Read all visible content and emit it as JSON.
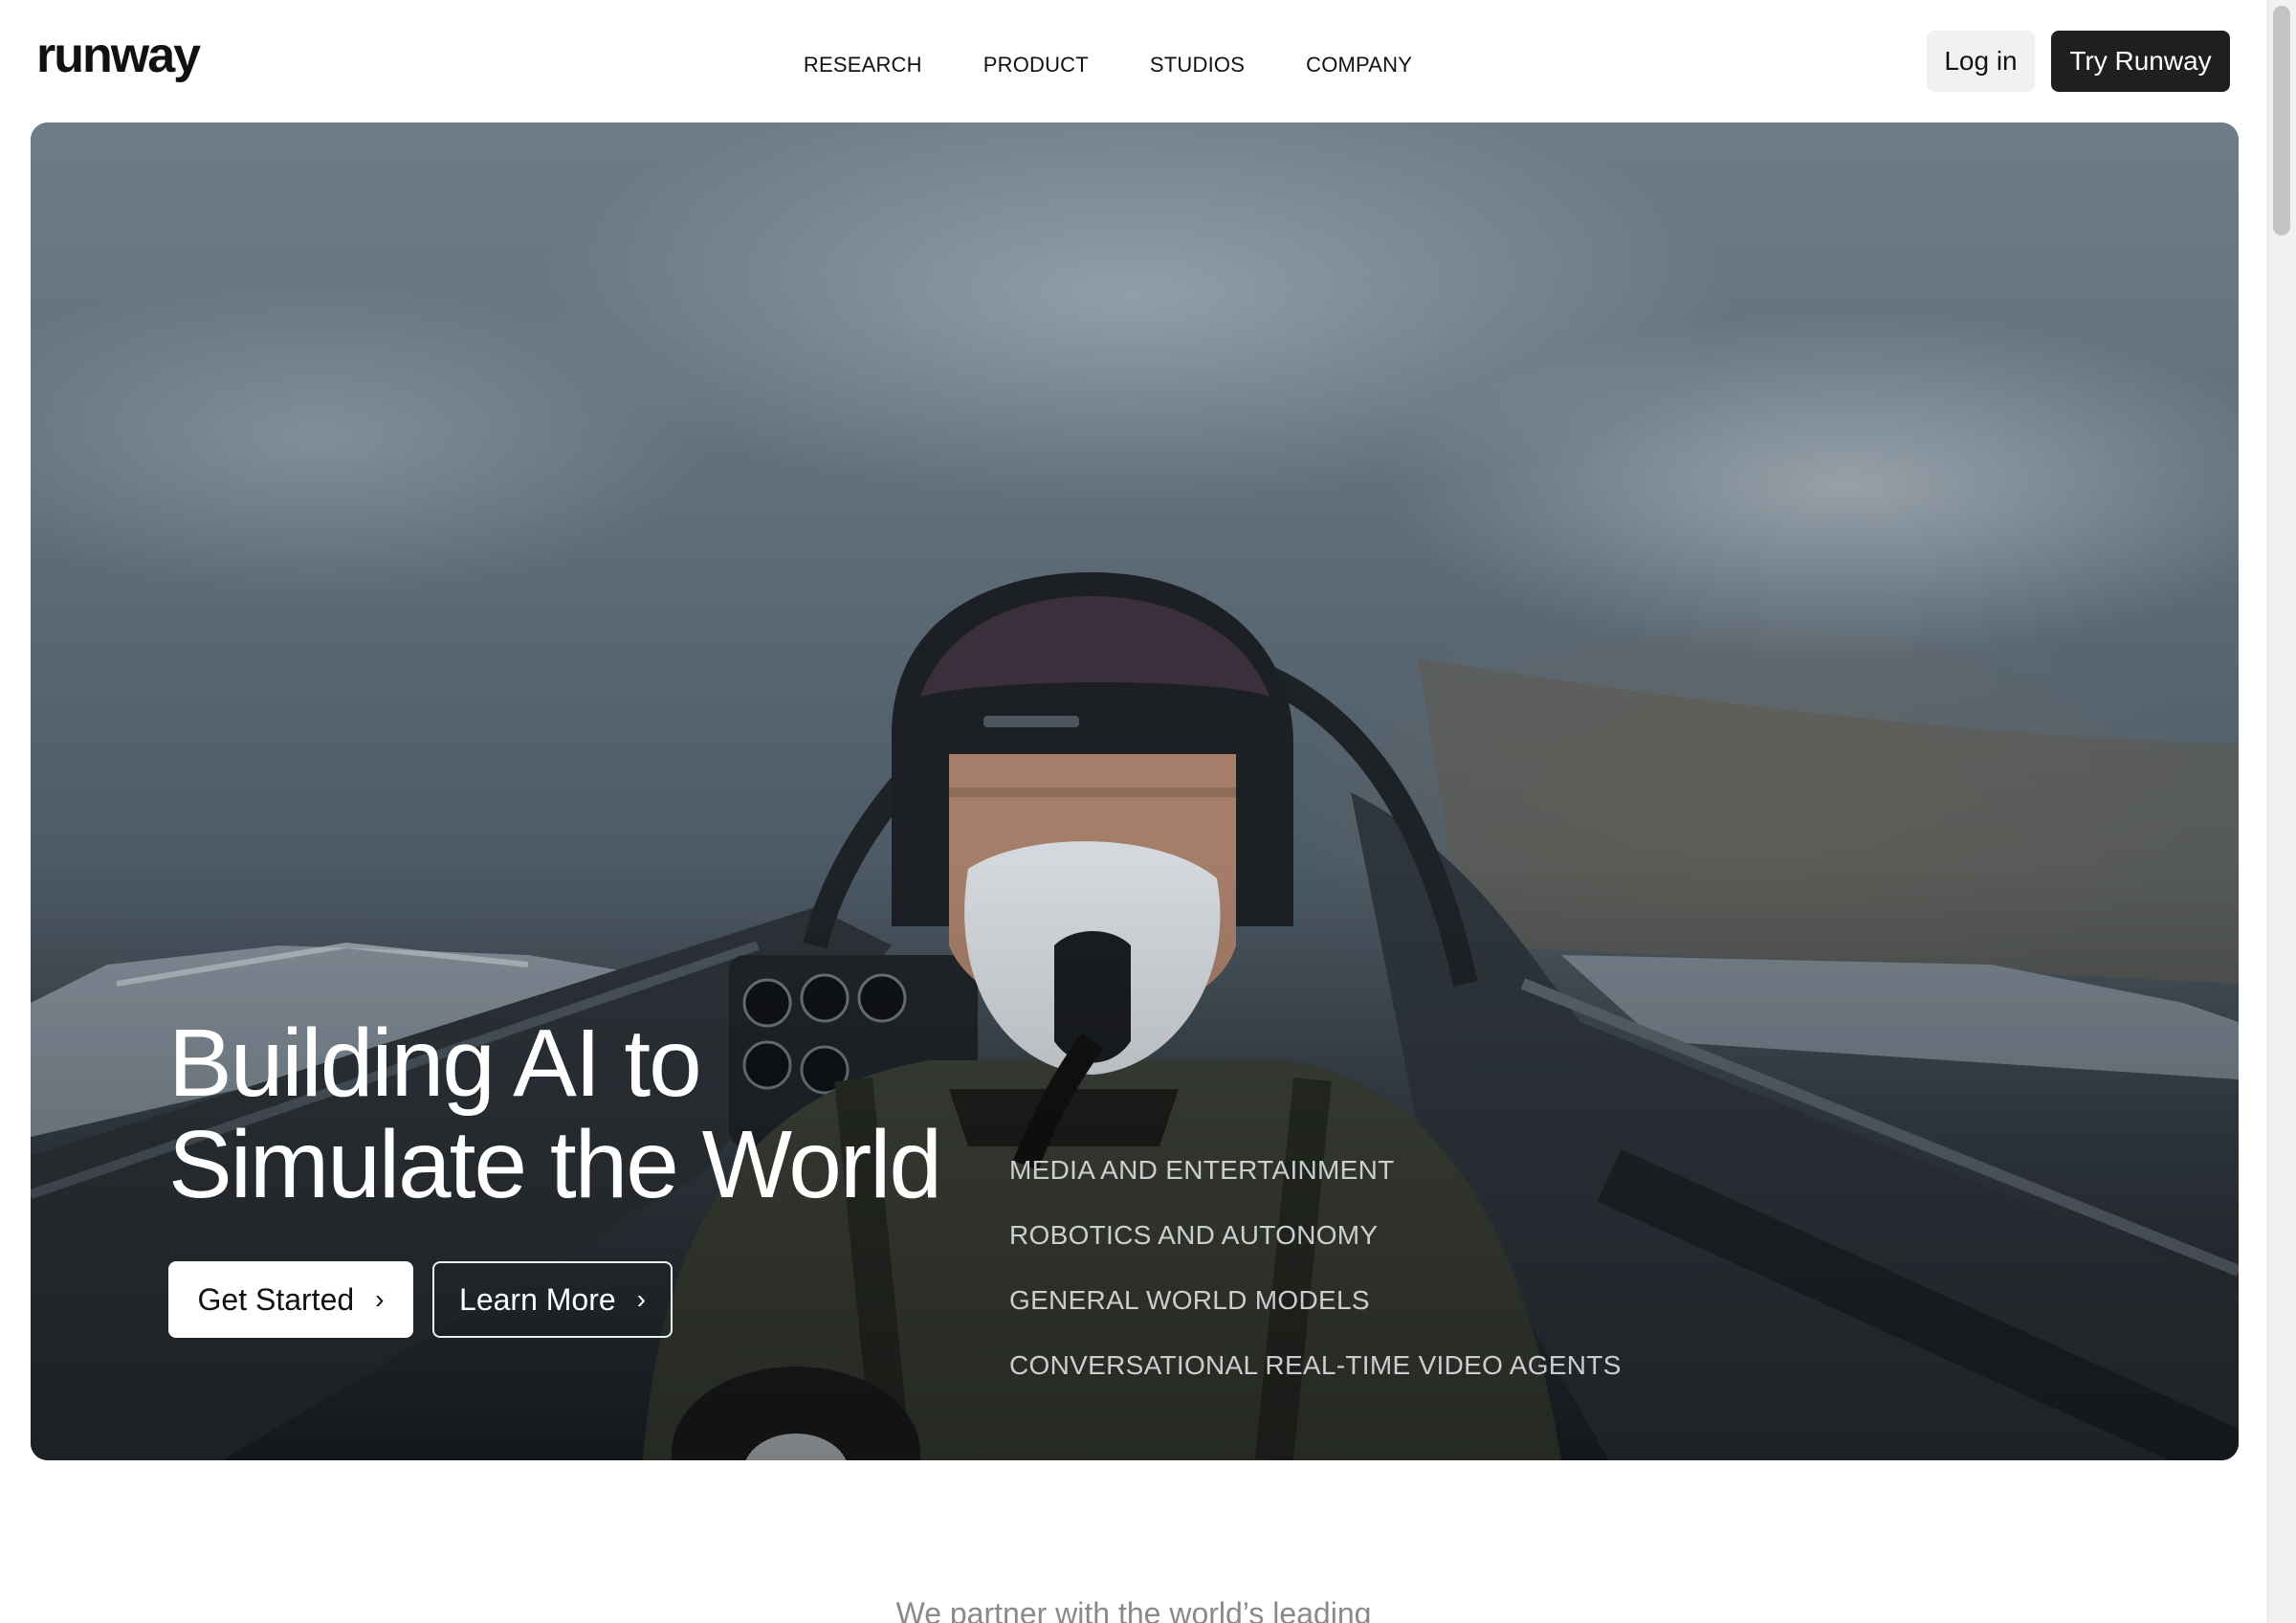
{
  "header": {
    "logo": "runway",
    "nav": [
      "RESEARCH",
      "PRODUCT",
      "STUDIOS",
      "COMPANY"
    ],
    "login_label": "Log in",
    "try_label": "Try Runway"
  },
  "hero": {
    "title_line1": "Building AI to",
    "title_line2": "Simulate the World",
    "get_started_label": "Get Started",
    "learn_more_label": "Learn More",
    "sectors": [
      "MEDIA AND ENTERTAINMENT",
      "ROBOTICS AND AUTONOMY",
      "GENERAL WORLD MODELS",
      "CONVERSATIONAL REAL-TIME VIDEO AGENTS"
    ]
  },
  "partner_text": "We partner with the world’s leading",
  "colors": {
    "try_button_bg": "#1f1f20",
    "login_button_bg": "#f0f1f2",
    "text_primary": "#111111"
  },
  "icons": {
    "button_chevron": "chevron-right-icon"
  }
}
